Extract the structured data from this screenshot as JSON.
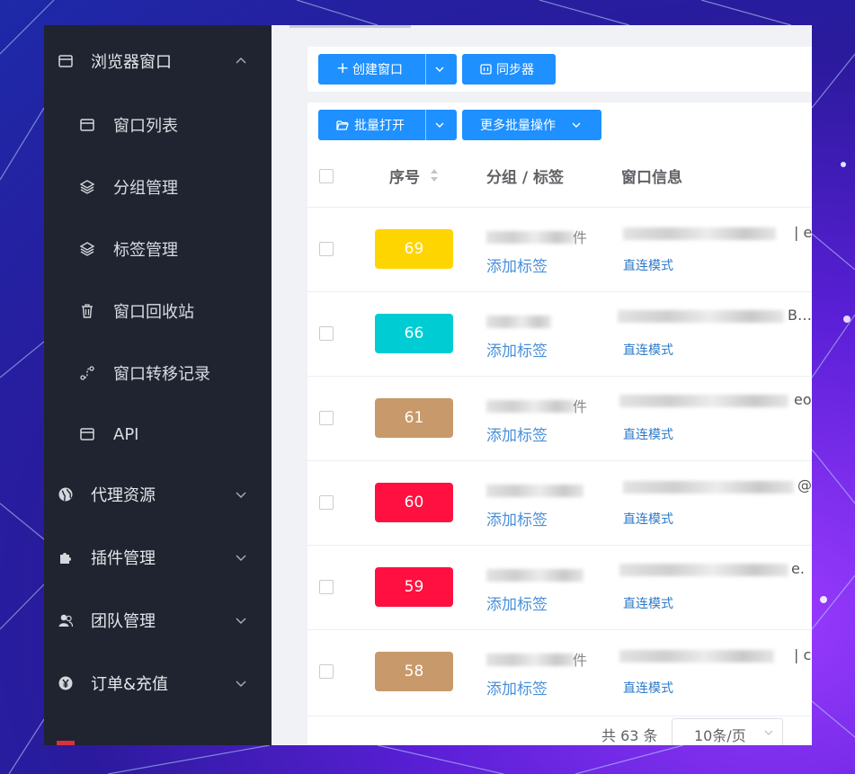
{
  "sidebar": {
    "browser_window": {
      "label": "浏览器窗口",
      "icon": "window-icon"
    },
    "items": [
      {
        "label": "窗口列表",
        "icon": "window-icon"
      },
      {
        "label": "分组管理",
        "icon": "layers-icon"
      },
      {
        "label": "标签管理",
        "icon": "layers-icon"
      },
      {
        "label": "窗口回收站",
        "icon": "trash-icon"
      },
      {
        "label": "窗口转移记录",
        "icon": "transfer-icon"
      },
      {
        "label": "API",
        "icon": "window-icon"
      }
    ],
    "groups": [
      {
        "label": "代理资源",
        "icon": "globe-icon"
      },
      {
        "label": "插件管理",
        "icon": "puzzle-icon"
      },
      {
        "label": "团队管理",
        "icon": "team-icon"
      },
      {
        "label": "订单&充值",
        "icon": "yen-icon"
      }
    ]
  },
  "toolbar": {
    "create_window": "创建窗口",
    "sync": "同步器",
    "batch_open": "批量打开",
    "more_batch": "更多批量操作"
  },
  "table": {
    "headers": {
      "index": "序号",
      "group_tag": "分组 / 标签",
      "window_info": "窗口信息"
    },
    "rows": [
      {
        "index": "69",
        "color": "#ffd500",
        "add_tag": "添加标签",
        "mode": "直连模式",
        "info_tail": "| e",
        "group_tail": "件"
      },
      {
        "index": "66",
        "color": "#00ccd3",
        "add_tag": "添加标签",
        "mode": "直连模式",
        "info_tail": "B…",
        "group_tail": ""
      },
      {
        "index": "61",
        "color": "#c8996a",
        "add_tag": "添加标签",
        "mode": "直连模式",
        "info_tail": "eo",
        "group_tail": "件"
      },
      {
        "index": "60",
        "color": "#ff1040",
        "add_tag": "添加标签",
        "mode": "直连模式",
        "info_tail": "@",
        "group_tail": ""
      },
      {
        "index": "59",
        "color": "#ff1040",
        "add_tag": "添加标签",
        "mode": "直连模式",
        "info_tail": "e.",
        "group_tail": ""
      },
      {
        "index": "58",
        "color": "#c8996a",
        "add_tag": "添加标签",
        "mode": "直连模式",
        "info_tail": "| c",
        "group_tail": "件"
      }
    ]
  },
  "pagination": {
    "total": "共 63 条",
    "page_size": "10条/页"
  }
}
